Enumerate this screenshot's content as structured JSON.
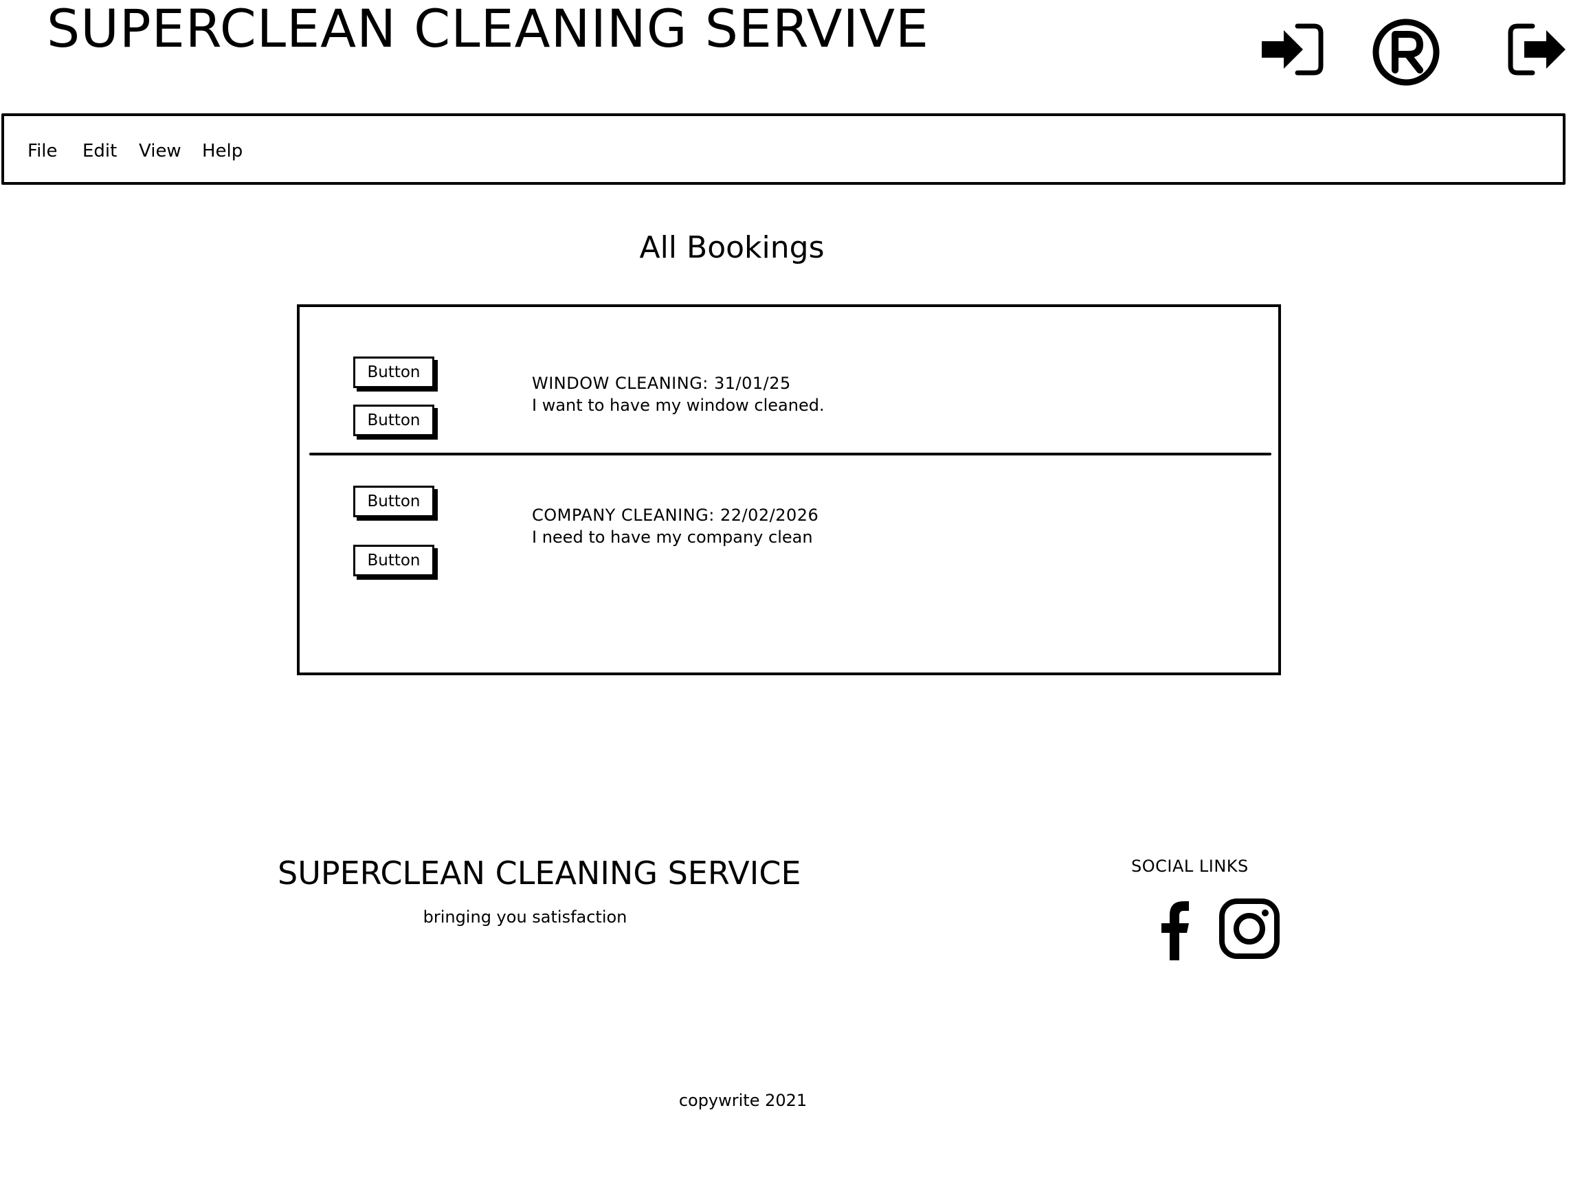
{
  "header": {
    "site_title": "SUPERCLEAN CLEANING SERVIVE",
    "icons": [
      "login-icon",
      "registered-icon",
      "logout-icon"
    ]
  },
  "menubar": {
    "items": [
      "File",
      "Edit",
      "View",
      "Help"
    ]
  },
  "main": {
    "heading": "All Bookings",
    "bookings": [
      {
        "title": "WINDOW CLEANING:  31/01/25",
        "description": "I want to have my window cleaned.",
        "buttons": [
          "Button",
          "Button"
        ]
      },
      {
        "title": "COMPANY CLEANING: 22/02/2026",
        "description": "I need to have my company clean",
        "buttons": [
          "Button",
          "Button"
        ]
      }
    ]
  },
  "footer": {
    "brand": "SUPERCLEAN CLEANING SERVICE",
    "tagline": "bringing you satisfaction",
    "social_heading": "SOCIAL LINKS",
    "social_icons": [
      "facebook-icon",
      "instagram-icon"
    ],
    "copyright": "copywrite 2021"
  }
}
